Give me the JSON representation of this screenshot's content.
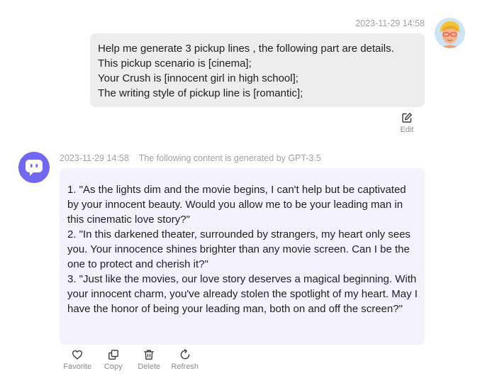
{
  "user_message": {
    "timestamp": "2023-11-29 14:58",
    "lines": [
      "Help me generate 3 pickup lines , the following part are details.",
      "This pickup scenario is [cinema];",
      "Your Crush is [innocent girl in high school];",
      "The writing style of pickup line is [romantic];"
    ],
    "edit_label": "Edit"
  },
  "bot_message": {
    "timestamp": "2023-11-29 14:58",
    "generated_by": "The following content is generated by GPT-3.5",
    "lines": [
      "1. \"As the lights dim and the movie begins, I can't help but be captivated by your innocent beauty. Would you allow me to be your leading man in this cinematic love story?\"",
      "2. \"In this darkened theater, surrounded by strangers, my heart only sees you. Your innocence shines brighter than any movie screen. Can I be the one to protect and cherish it?\"",
      "3. \"Just like the movies, our love story deserves a magical beginning. With your innocent charm, you've already stolen the spotlight of my heart. May I have the honor of being your leading man, both on and off the screen?\""
    ],
    "actions": {
      "favorite": "Favorite",
      "copy": "Copy",
      "delete": "Delete",
      "refresh": "Refresh"
    }
  },
  "colors": {
    "user_bubble": "#ededed",
    "bot_bubble": "#f3f2fd",
    "bot_avatar": "#7267f0",
    "meta_text": "#a3a3a3"
  },
  "icons": {
    "edit": "edit-icon",
    "favorite": "heart-icon",
    "copy": "copy-icon",
    "delete": "trash-icon",
    "refresh": "refresh-icon"
  }
}
